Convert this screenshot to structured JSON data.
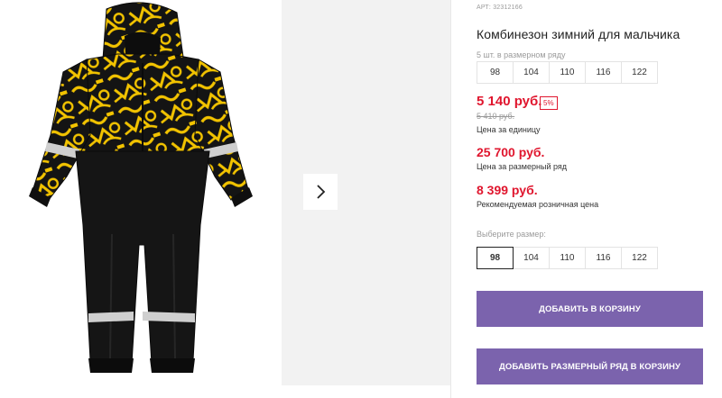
{
  "gallery": {
    "main_photo_alt": "",
    "next_icon": "chevron-right-icon"
  },
  "product": {
    "article": "АРТ: 32312166",
    "title": "Комбинезон зимний для мальчика"
  },
  "pack": {
    "label": "5 шт. в размерном ряду",
    "sizes": [
      "98",
      "104",
      "110",
      "116",
      "122"
    ]
  },
  "prices": {
    "unit_price": "5 140 руб.",
    "discount": "5%",
    "old_price": "5 410 руб.",
    "unit_caption": "Цена за единицу",
    "row_price": "25 700 руб.",
    "row_caption": "Цена за размерный ряд",
    "rrp_price": "8 399 руб.",
    "rrp_caption": "Рекомендуемая розничная цена"
  },
  "size_picker": {
    "label": "Выберите размер:",
    "sizes": [
      "98",
      "104",
      "110",
      "116",
      "122"
    ],
    "selected": "98"
  },
  "actions": {
    "add_to_cart": "ДОБАВИТЬ В КОРЗИНУ",
    "add_row_to_cart": "ДОБАВИТЬ РАЗМЕРНЫЙ РЯД В КОРЗИНУ"
  },
  "colors": {
    "accent_price": "#e0162e",
    "button": "#7b63ad",
    "suit_black": "#141414",
    "suit_yellow": "#f2c300"
  }
}
